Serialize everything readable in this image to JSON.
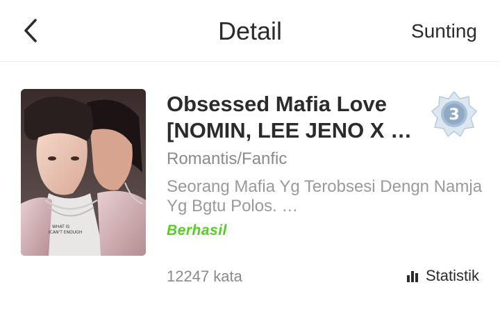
{
  "header": {
    "title": "Detail",
    "edit_label": "Sunting",
    "back_icon": "chevron-left-icon"
  },
  "story": {
    "title_line1": "Obsessed Mafia Love",
    "title_line2": "[NOMIN, LEE JENO X …",
    "badge_number": "3",
    "genre": "Romantis/Fanfic",
    "description_line1": "Seorang Mafia Yg Terobsesi Dengn Namja",
    "description_line2": "Yg Bgtu Polos. …",
    "status": "Berhasil",
    "word_count": "12247 kata",
    "stats_label": "Statistik",
    "stats_icon": "bar-chart-icon",
    "cover_shirt_text_1": "WHAT IS",
    "cover_shirt_text_2": "ICAN'T ENOUGH"
  },
  "colors": {
    "status_green": "#55cf1e",
    "badge_silver": "#c9d9e8"
  }
}
